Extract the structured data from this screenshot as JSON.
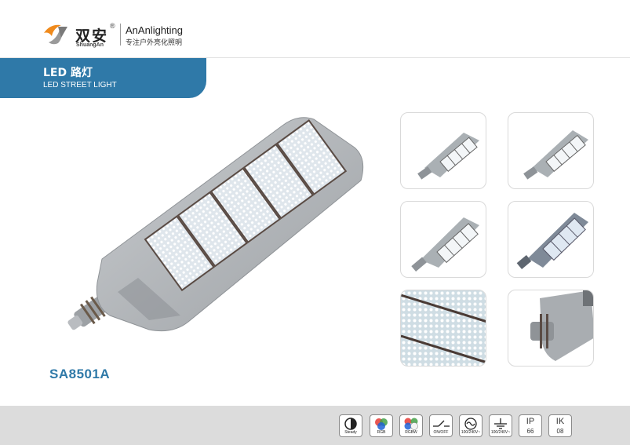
{
  "brand": {
    "name_cn": "双安",
    "pinyin": "ShuangAn",
    "name_en": "AnAnlighting",
    "slogan": "专注户外亮化照明",
    "registered_mark": "®"
  },
  "banner": {
    "title_cn": "LED 路灯",
    "title_en": "LED STREET LIGHT"
  },
  "product": {
    "model": "SA8501A"
  },
  "feature_icons": [
    {
      "icon": "steady-icon",
      "label": "Steady"
    },
    {
      "icon": "rgb-icon",
      "label": "RGB"
    },
    {
      "icon": "rgbw-icon",
      "label": "RGBW"
    },
    {
      "icon": "switch-icon",
      "label": "ON/OFF"
    },
    {
      "icon": "ac-voltage-icon",
      "label": "100/240V~"
    },
    {
      "icon": "ground-icon",
      "label": "100/240V~"
    },
    {
      "icon": "ip-rating",
      "top": "IP",
      "bottom": "66"
    },
    {
      "icon": "ik-rating",
      "top": "IK",
      "bottom": "08"
    }
  ],
  "colors": {
    "accent": "#2f79a8",
    "footer": "#dcdcdc",
    "housing": "#a8acb0"
  }
}
